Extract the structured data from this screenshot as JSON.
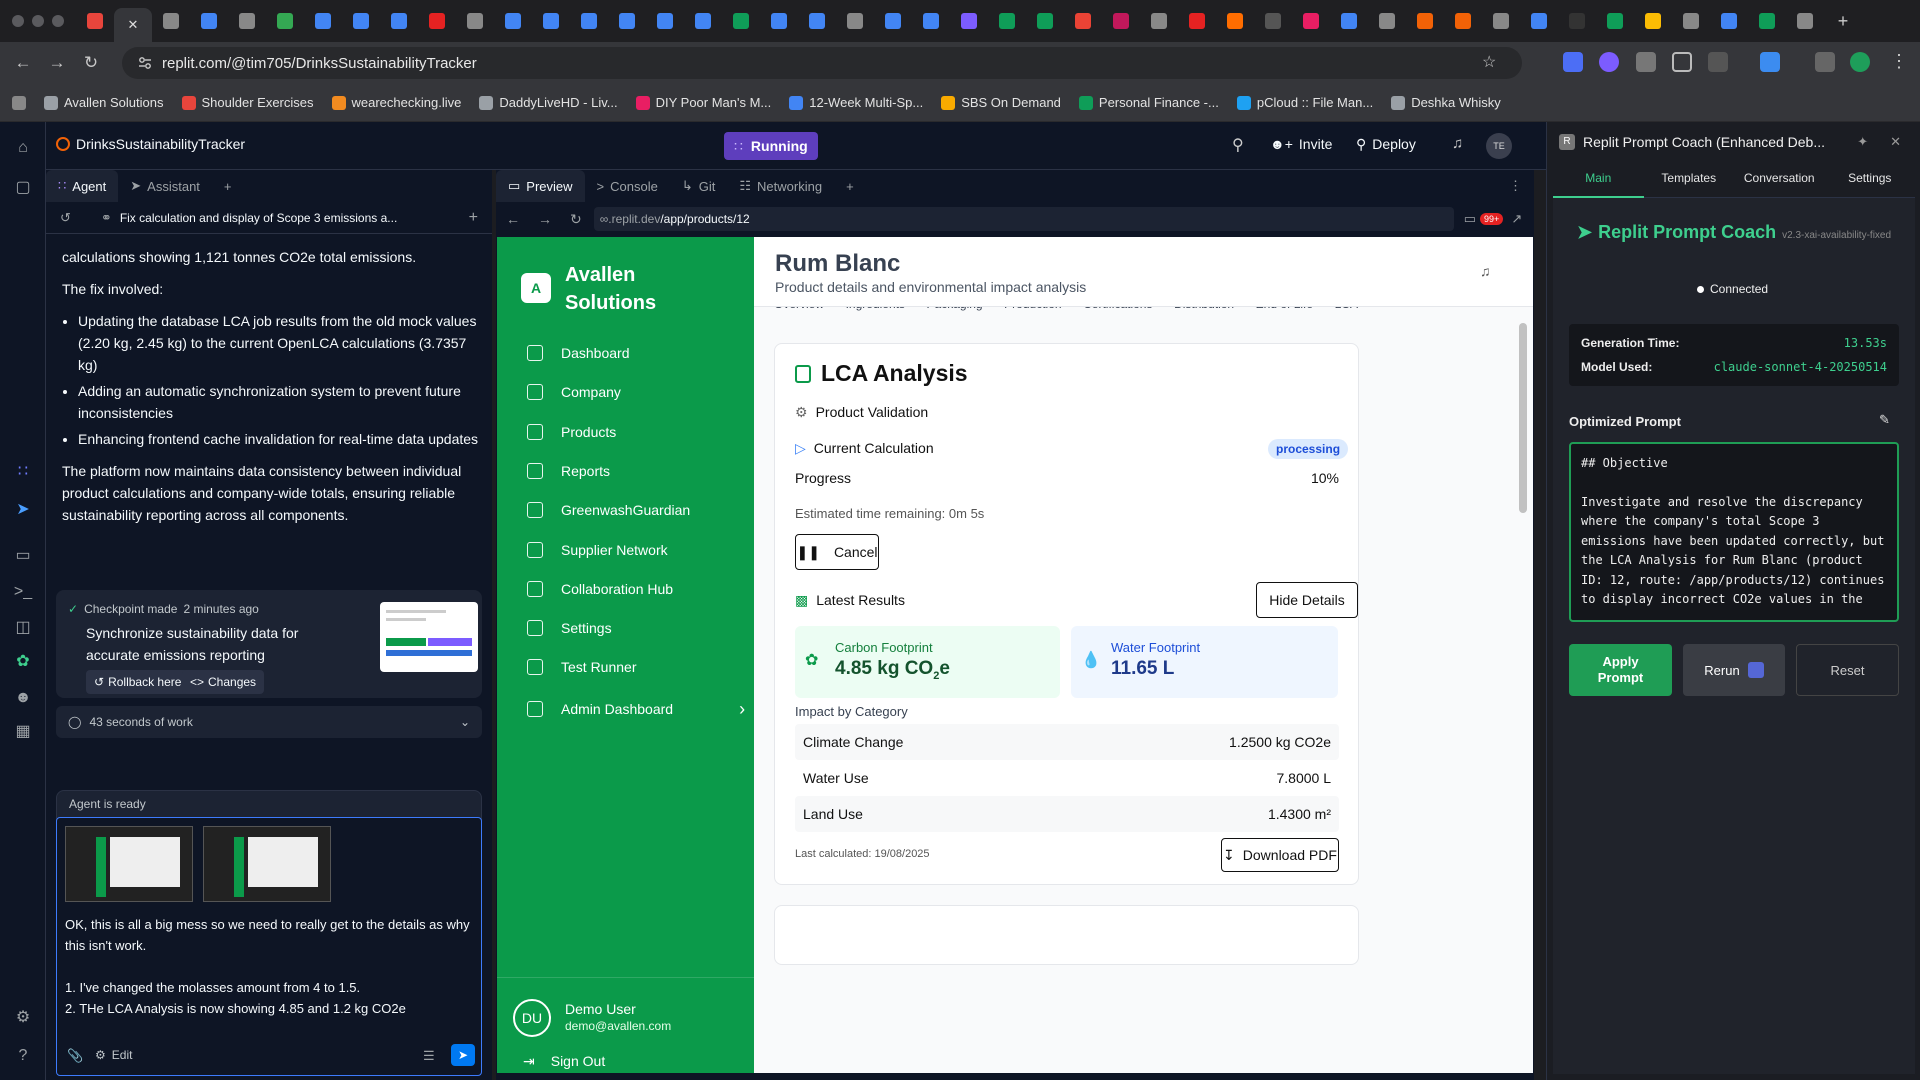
{
  "browser": {
    "url": "replit.com/@tim705/DrinksSustainabilityTracker",
    "bookmarks": [
      {
        "label": "Avallen Solutions",
        "color": "#9aa0a6"
      },
      {
        "label": "Shoulder Exercises",
        "color": "#e8453c"
      },
      {
        "label": "wearechecking.live",
        "color": "#f28b20"
      },
      {
        "label": "DaddyLiveHD - Liv...",
        "color": "#9aa0a6"
      },
      {
        "label": "DIY Poor Man's M...",
        "color": "#e91e63"
      },
      {
        "label": "12-Week Multi-Sp...",
        "color": "#4285f4"
      },
      {
        "label": "SBS On Demand",
        "color": "#f9ab00"
      },
      {
        "label": "Personal Finance -...",
        "color": "#0f9d58"
      },
      {
        "label": "pCloud :: File Man...",
        "color": "#1ea1f2"
      },
      {
        "label": "Deshka Whisky",
        "color": "#9aa0a6"
      }
    ]
  },
  "replit": {
    "project_name": "DrinksSustainabilityTracker",
    "run_status": "Running",
    "invite_label": "Invite",
    "deploy_label": "Deploy",
    "avatar_initials": "TE",
    "left_tabs": [
      "Agent",
      "Assistant"
    ],
    "thread_title": "Fix calculation and display of Scope 3 emissions a...",
    "preview_tabs": [
      "Preview",
      "Console",
      "Git",
      "Networking"
    ],
    "preview_url_prefix": ".replit.dev",
    "preview_url_path": "/app/products/12",
    "notif_badge": "99+"
  },
  "chat": {
    "intro_tail": "calculations showing 1,121 tonnes CO2e total emissions.",
    "fix_heading": "The fix involved:",
    "bullets": [
      "Updating the database LCA job results from the old mock values (2.20 kg, 2.45 kg) to the current OpenLCA calculations (3.7357 kg)",
      "Adding an automatic synchronization system to prevent future inconsistencies",
      "Enhancing frontend cache invalidation for real-time data updates"
    ],
    "summary": "The platform now maintains data consistency between individual product calculations and company-wide totals, ensuring reliable sustainability reporting across all components.",
    "checkpoint_label": "Checkpoint made",
    "checkpoint_time": "2 minutes ago",
    "checkpoint_title": "Synchronize sustainability data for accurate emissions reporting",
    "rollback_label": "Rollback here",
    "changes_label": "Changes",
    "work_summary": "43 seconds of work",
    "agent_status": "Agent is ready",
    "input_line1": "OK, this is all a big mess so we need to really get to the details as why this isn't work.",
    "input_line2": "1. I've changed the molasses amount from 4 to 1.5.",
    "input_line3": "2. THe LCA Analysis is now showing 4.85 and 1.2 kg CO2e",
    "edit_label": "Edit"
  },
  "app": {
    "brand_line1": "Avallen",
    "brand_line2": "Solutions",
    "logo_letter": "A",
    "nav": [
      "Dashboard",
      "Company",
      "Products",
      "Reports",
      "GreenwashGuardian",
      "Supplier Network",
      "Collaboration Hub",
      "Settings",
      "Test Runner",
      "Admin Dashboard"
    ],
    "user_initials": "DU",
    "user_name": "Demo User",
    "user_email": "demo@avallen.com",
    "sign_out": "Sign Out",
    "page_title": "Rum Blanc",
    "page_subtitle": "Product details and environmental impact analysis",
    "sub_tabs": [
      "Overview",
      "Ingredients",
      "Packaging",
      "Production",
      "Certifications",
      "Distribution",
      "End of Life",
      "LCA"
    ],
    "lca_title": "LCA Analysis",
    "product_validation": "Product Validation",
    "current_calc": "Current Calculation",
    "status_badge": "processing",
    "progress_label": "Progress",
    "progress_value": "10%",
    "progress_fraction": 0.1,
    "eta": "Estimated time remaining: 0m 5s",
    "cancel_label": "Cancel",
    "latest_results": "Latest Results",
    "hide_details": "Hide Details",
    "carbon_label": "Carbon Footprint",
    "carbon_value": "4.85 kg CO",
    "carbon_sub": "2",
    "carbon_suffix": "e",
    "water_label": "Water Footprint",
    "water_value": "11.65 L",
    "impact_heading": "Impact by Category",
    "categories": [
      {
        "name": "Climate Change",
        "value": "1.2500 kg CO2e"
      },
      {
        "name": "Water Use",
        "value": "7.8000 L"
      },
      {
        "name": "Land Use",
        "value": "1.4300 m²"
      }
    ],
    "last_calculated": "Last calculated: 19/08/2025",
    "download_pdf": "Download PDF"
  },
  "coach": {
    "header_title": "Replit Prompt Coach (Enhanced Deb...",
    "tabs": [
      "Main",
      "Templates",
      "Conversation",
      "Settings"
    ],
    "title": "Replit Prompt Coach",
    "version": "v2.3-xai-availability-fixed",
    "connection": "Connected",
    "gen_time_label": "Generation Time:",
    "gen_time_value": "13.53s",
    "model_label": "Model Used:",
    "model_value": "claude-sonnet-4-20250514",
    "optimized_label": "Optimized Prompt",
    "prompt_heading": "## Objective",
    "prompt_body": "Investigate and resolve the discrepancy where the company's total Scope 3 emissions have been updated correctly, but the LCA Analysis for Rum Blanc (product ID: 12, route: /app/products/12) continues to display incorrect CO2e values in the",
    "apply_label": "Apply Prompt",
    "rerun_label": "Rerun",
    "reset_label": "Reset"
  },
  "colors": {
    "brand_green": "#0b9a4a",
    "running_purple": "#5e3ebd",
    "coach_green": "#1f9d55"
  }
}
